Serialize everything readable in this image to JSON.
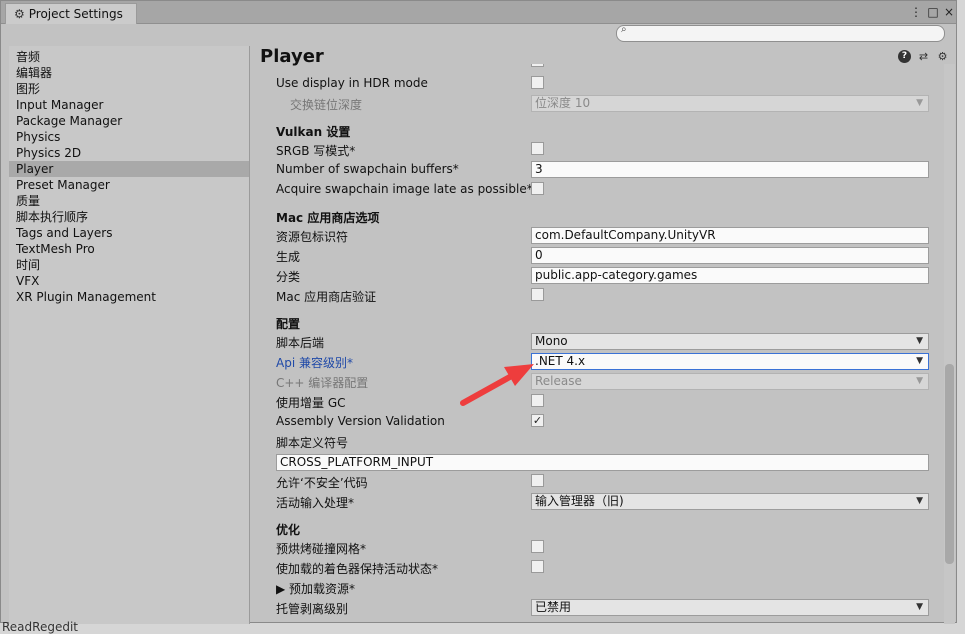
{
  "window": {
    "title": "Project Settings",
    "controls": [
      "⋮",
      "□",
      "×"
    ]
  },
  "sidebar": {
    "items": [
      {
        "label": "音频"
      },
      {
        "label": "编辑器"
      },
      {
        "label": "图形"
      },
      {
        "label": "Input Manager"
      },
      {
        "label": "Package Manager"
      },
      {
        "label": "Physics"
      },
      {
        "label": "Physics 2D"
      },
      {
        "label": "Player"
      },
      {
        "label": "Preset Manager"
      },
      {
        "label": "质量"
      },
      {
        "label": "脚本执行顺序"
      },
      {
        "label": "Tags and Layers"
      },
      {
        "label": "TextMesh Pro"
      },
      {
        "label": "时间"
      },
      {
        "label": "VFX"
      },
      {
        "label": "XR Plugin Management"
      }
    ],
    "selected": "Player"
  },
  "main": {
    "title": "Player",
    "header_icons": [
      "help-icon",
      "preset-icon",
      "settings-icon"
    ],
    "rows": {
      "hdr": "Use display in HDR mode",
      "swapdepth_label": "交换链位深度",
      "swapdepth_value": "位深度 10",
      "vulkan_section": "Vulkan 设置",
      "srgb": "SRGB 写模式*",
      "swapbuf_label": "Number of swapchain buffers*",
      "swapbuf_value": "3",
      "acquire": "Acquire swapchain image late as possible*",
      "mac_section": "Mac 应用商店选项",
      "bundle_label": "资源包标识符",
      "bundle_value": "com.DefaultCompany.UnityVR",
      "build_label": "生成",
      "build_value": "0",
      "category_label": "分类",
      "category_value": "public.app-category.games",
      "macvalid": "Mac 应用商店验证",
      "config_section": "配置",
      "backend_label": "脚本后端",
      "backend_value": "Mono",
      "api_label": "Api 兼容级别*",
      "api_value": ".NET 4.x",
      "cpp_label": "C++ 编译器配置",
      "cpp_value": "Release",
      "gc": "使用增量 GC",
      "asmvalid": "Assembly Version Validation",
      "defines_label": "脚本定义符号",
      "defines_value": "CROSS_PLATFORM_INPUT",
      "unsafe": "允许‘不安全’代码",
      "input_label": "活动输入处理*",
      "input_value": "输入管理器（旧)",
      "opt_section": "优化",
      "prebake": "预烘烤碰撞网格*",
      "keepshaders": "使加载的着色器保持活动状态*",
      "preload": "▶ 预加载资源*",
      "strip_label": "托管剥离级别",
      "strip_value": "已禁用"
    }
  },
  "background_text": "ReadRegedit",
  "colors": {
    "accent_arrow": "#ee3d3d",
    "link_label": "#1f49a8"
  }
}
